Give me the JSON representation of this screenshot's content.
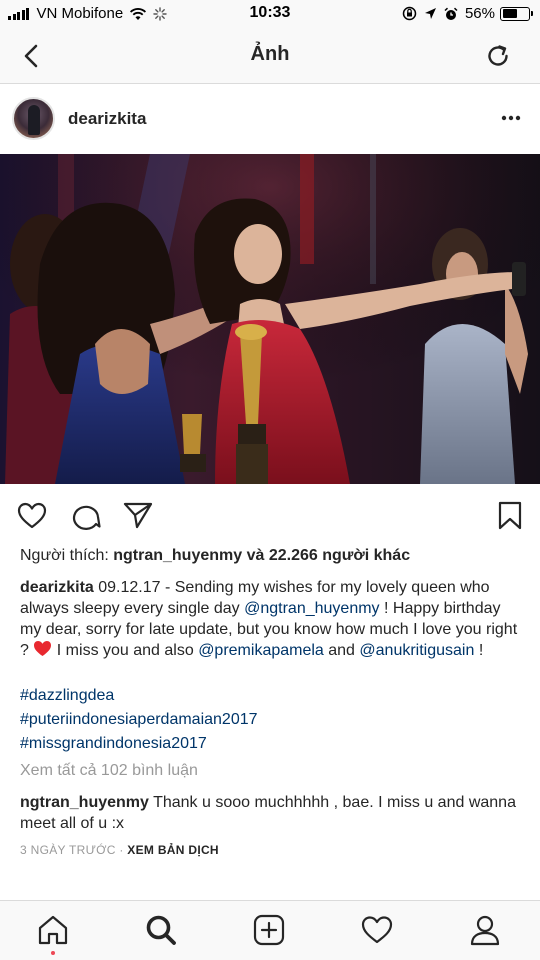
{
  "status_bar": {
    "carrier": "VN Mobifone",
    "time": "10:33",
    "battery": "56%",
    "battery_level": 0.56
  },
  "nav": {
    "title": "Ảnh",
    "back_icon": "chevron-left-icon",
    "refresh_icon": "refresh-icon"
  },
  "post": {
    "username": "dearizkita",
    "likes": {
      "prefix": "Người thích: ",
      "user": "ngtran_huyenmy",
      "suffix": " và 22.266 người khác"
    },
    "caption": {
      "author": "dearizkita",
      "text_1": " 09.12.17 - Sending my wishes for my lovely queen who always sleepy every single day ",
      "mention_1": "@ngtran_huyenmy",
      "text_2": " ! Happy birthday my dear, sorry for late update, but you know how much I love you right ? ",
      "text_3": " I miss you and also ",
      "mention_2": "@premikapamela",
      "text_4": " and ",
      "mention_3": "@anukritigusain",
      "text_5": " !"
    },
    "hashtags": [
      "#dazzlingdea",
      "#puteriindonesiaperdamaian2017",
      "#missgrandindonesia2017"
    ],
    "view_all_comments": "Xem tất cả 102 bình luận",
    "comment": {
      "author": "ngtran_huyenmy",
      "text": " Thank u sooo muchhhhh , bae. I miss u and wanna meet all of u :x"
    },
    "time_ago": "3 NGÀY TRƯỚC",
    "separator": " · ",
    "translate": "XEM BẢN DỊCH"
  },
  "tab_bar": [
    "home-icon",
    "search-icon",
    "new-post-icon",
    "activity-heart-icon",
    "profile-icon"
  ],
  "colors": {
    "text": "#262626",
    "link": "#003569",
    "muted": "#999999",
    "notification": "#ed4956",
    "heart_emoji": "#e8282f",
    "bar_bg": "#f9f9f9"
  }
}
